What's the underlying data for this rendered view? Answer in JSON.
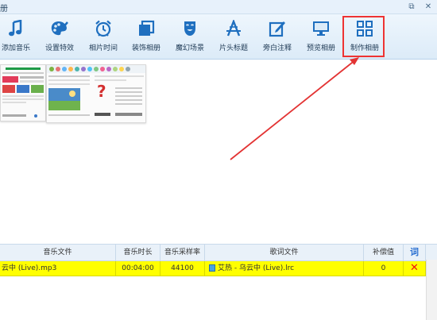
{
  "window": {
    "title": "册",
    "buttons": [
      "restore-icon",
      "close-icon"
    ]
  },
  "toolbar": {
    "items": [
      {
        "label": "添加音乐",
        "icon": "music-note-icon"
      },
      {
        "label": "设置特效",
        "icon": "palette-icon"
      },
      {
        "label": "相片时间",
        "icon": "alarm-clock-icon"
      },
      {
        "label": "装饰相册",
        "icon": "album-frames-icon"
      },
      {
        "label": "魔幻场景",
        "icon": "theater-mask-icon"
      },
      {
        "label": "片头标题",
        "icon": "caption-a-icon"
      },
      {
        "label": "旁白注释",
        "icon": "edit-note-icon"
      },
      {
        "label": "预览相册",
        "icon": "monitor-icon"
      },
      {
        "label": "制作相册",
        "icon": "grid-icon"
      }
    ],
    "accent": "#1f6fbf",
    "highlight_color": "#e33333"
  },
  "music_table": {
    "headers": {
      "file": "音乐文件",
      "duration": "音乐时长",
      "sample_rate": "音乐采样率",
      "lyric_file": "歌词文件",
      "offset": "补偿值",
      "lyric": "词"
    },
    "rows": [
      {
        "file": "云中 (Live).mp3",
        "duration": "00:04:00",
        "sample_rate": "44100",
        "lyric_file": "艾热 - 乌云中 (Live).lrc",
        "offset": "0"
      }
    ],
    "row_color": "#ffff00"
  }
}
